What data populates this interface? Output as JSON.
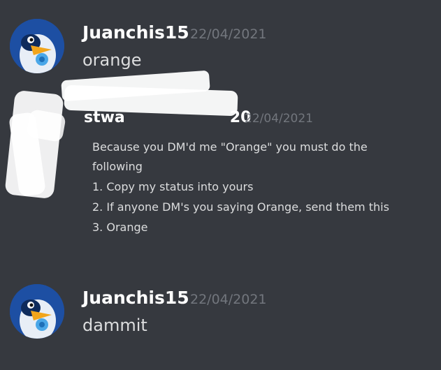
{
  "messages": [
    {
      "author": "Juanchis15",
      "date": "22/04/2021",
      "text": "orange"
    },
    {
      "author": "Juanchis15",
      "date": "22/04/2021",
      "text": "dammit"
    }
  ],
  "quoted_screenshot": {
    "author_partial": "stwa",
    "author_tail": "20",
    "date": "22/04/2021",
    "lines": [
      "Because you DM'd me \"Orange\" you must do the",
      "following",
      "1. Copy my status into yours",
      "2. If anyone DM's you saying Orange, send them this",
      "3. Orange"
    ]
  },
  "colors": {
    "background": "#36393f",
    "username": "#ffffff",
    "timestamp": "#72767d",
    "message_text": "#dcddde"
  }
}
